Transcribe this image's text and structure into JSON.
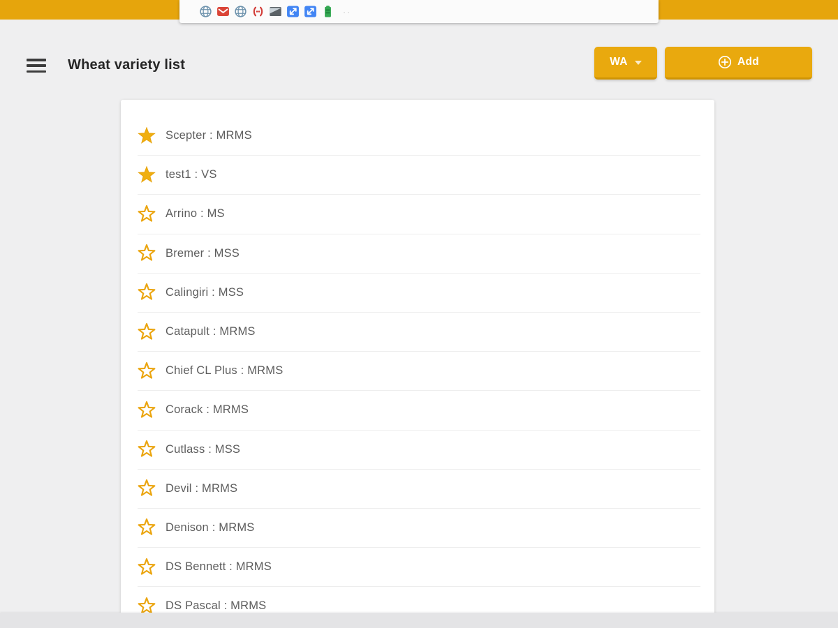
{
  "status_bar": {
    "icons": [
      {
        "name": "globe-icon",
        "type": "globe"
      },
      {
        "name": "gmail-icon",
        "type": "mail"
      },
      {
        "name": "globe-icon",
        "type": "globe"
      },
      {
        "name": "code-brackets-icon",
        "type": "parens"
      },
      {
        "name": "screenshot-icon",
        "type": "photo"
      },
      {
        "name": "download-icon",
        "type": "download"
      },
      {
        "name": "download-icon",
        "type": "download"
      },
      {
        "name": "battery-icon",
        "type": "battery"
      }
    ],
    "overflow_dots": "··"
  },
  "header": {
    "title": "Wheat variety list",
    "region_button": {
      "label": "WA"
    },
    "add_button": {
      "label": "Add"
    }
  },
  "list": {
    "items": [
      {
        "label": "Scepter : MRMS",
        "favorite": true
      },
      {
        "label": "test1 : VS",
        "favorite": true
      },
      {
        "label": "Arrino : MS",
        "favorite": false
      },
      {
        "label": "Bremer : MSS",
        "favorite": false
      },
      {
        "label": "Calingiri : MSS",
        "favorite": false
      },
      {
        "label": "Catapult : MRMS",
        "favorite": false
      },
      {
        "label": "Chief CL Plus : MRMS",
        "favorite": false
      },
      {
        "label": "Corack : MRMS",
        "favorite": false
      },
      {
        "label": "Cutlass : MSS",
        "favorite": false
      },
      {
        "label": "Devil : MRMS",
        "favorite": false
      },
      {
        "label": "Denison : MRMS",
        "favorite": false
      },
      {
        "label": "DS Bennett : MRMS",
        "favorite": false
      },
      {
        "label": "DS Pascal : MRMS",
        "favorite": false
      }
    ]
  },
  "colors": {
    "accent_gold": "#e6a50c",
    "button_gold": "#e9a90e",
    "star_gold": "#f0af10",
    "background": "#efeff0"
  }
}
